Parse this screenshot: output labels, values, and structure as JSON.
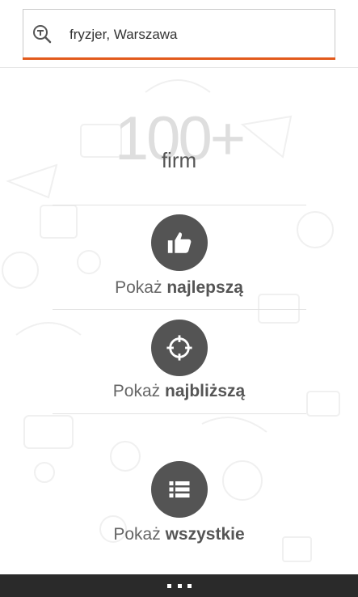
{
  "search": {
    "value": "fryzjer, Warszawa",
    "accent_color": "#e25a1c"
  },
  "results": {
    "count": "100+",
    "unit": "firm"
  },
  "actions": [
    {
      "prefix": "Pokaż",
      "emphasis": "najlepszą",
      "icon": "thumbs-up-icon"
    },
    {
      "prefix": "Pokaż",
      "emphasis": "najbliższą",
      "icon": "target-icon"
    },
    {
      "prefix": "Pokaż",
      "emphasis": "wszystkie",
      "icon": "list-icon"
    }
  ],
  "app_bar": {
    "more_icon": "ellipsis-icon"
  },
  "colors": {
    "circle": "#545454",
    "app_bar": "#2a2a2a"
  }
}
